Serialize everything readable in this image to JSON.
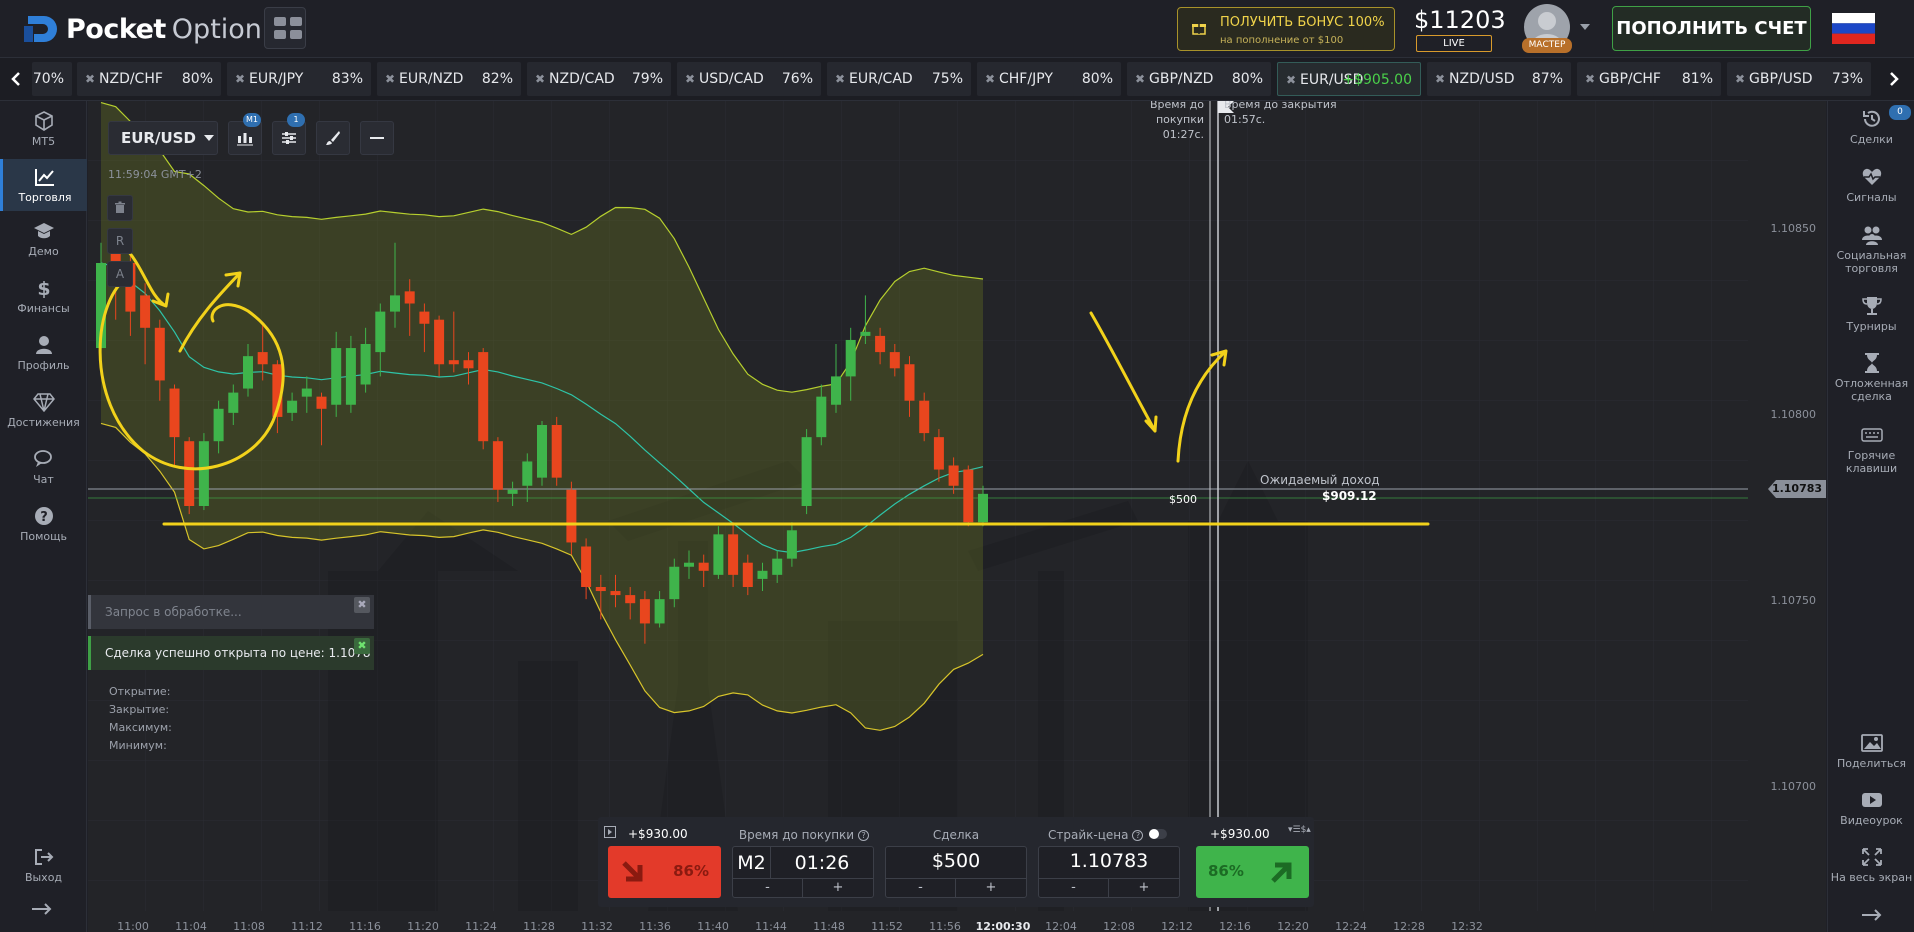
{
  "app": {
    "brand_bold": "Pocket",
    "brand_light": "Option"
  },
  "header": {
    "bonus_title": "ПОЛУЧИТЬ БОНУС 100%",
    "bonus_sub": "на пополнение от $100",
    "balance": "$11203",
    "balance_mode": "LIVE",
    "avatar_badge": "МАСТЕР",
    "deposit_label": "ПОПОЛНИТЬ СЧЕТ"
  },
  "pairs": [
    {
      "name": "",
      "pct": "70%"
    },
    {
      "name": "NZD/CHF",
      "pct": "80%"
    },
    {
      "name": "EUR/JPY",
      "pct": "83%"
    },
    {
      "name": "EUR/NZD",
      "pct": "82%"
    },
    {
      "name": "NZD/CAD",
      "pct": "79%"
    },
    {
      "name": "USD/CAD",
      "pct": "76%"
    },
    {
      "name": "EUR/CAD",
      "pct": "75%"
    },
    {
      "name": "CHF/JPY",
      "pct": "80%"
    },
    {
      "name": "GBP/NZD",
      "pct": "80%"
    },
    {
      "name": "EUR/USD",
      "pct": "+$905.00"
    },
    {
      "name": "NZD/USD",
      "pct": "87%"
    },
    {
      "name": "GBP/CHF",
      "pct": "81%"
    },
    {
      "name": "GBP/USD",
      "pct": "73%"
    }
  ],
  "left_sidebar": [
    {
      "label": "MT5",
      "icon": "cube-icon"
    },
    {
      "label": "Торговля",
      "icon": "chart-line-icon"
    },
    {
      "label": "Демо",
      "icon": "graduation-cap-icon"
    },
    {
      "label": "Финансы",
      "icon": "dollar-icon"
    },
    {
      "label": "Профиль",
      "icon": "user-icon"
    },
    {
      "label": "Достижения",
      "icon": "diamond-icon"
    },
    {
      "label": "Чат",
      "icon": "chat-icon"
    },
    {
      "label": "Помощь",
      "icon": "help-icon"
    },
    {
      "label": "Выход",
      "icon": "logout-icon"
    }
  ],
  "right_sidebar": [
    {
      "label": "Сделки",
      "icon": "history-icon",
      "badge": "0"
    },
    {
      "label": "Сигналы",
      "icon": "heartbeat-icon"
    },
    {
      "label": "Социальная торговля",
      "icon": "users-icon"
    },
    {
      "label": "Турниры",
      "icon": "trophy-icon"
    },
    {
      "label": "Отложенная сделка",
      "icon": "hourglass-icon"
    },
    {
      "label": "Горячие клавиши",
      "icon": "keyboard-icon"
    },
    {
      "label": "Поделиться",
      "icon": "image-icon"
    },
    {
      "label": "Видеоурок",
      "icon": "video-icon"
    },
    {
      "label": "На весь экран",
      "icon": "fullscreen-icon"
    }
  ],
  "chart": {
    "pair": "EUR/USD",
    "timeframe_badge": "M1",
    "indicators_badge": "1",
    "clock": "11:59:04 GMT+2",
    "tool_trash": "🗑",
    "tool_r": "R",
    "tool_a": "A",
    "time_to_buy_label": "Время до покупки",
    "time_to_buy": "01:27c.",
    "time_to_close_label": "Время до закрытия",
    "time_to_close": "01:57c.",
    "expected_income_label": "Ожидаемый доход",
    "expected_income": "$909.12",
    "stake_marker": "$500",
    "current_price": "1.10783",
    "y_ticks": [
      "1.10850",
      "1.10800",
      "1.10750",
      "1.10700"
    ],
    "x_ticks": [
      "11:00",
      "11:04",
      "11:08",
      "11:12",
      "11:16",
      "11:20",
      "11:24",
      "11:28",
      "11:32",
      "11:36",
      "11:40",
      "11:44",
      "11:48",
      "11:52",
      "11:56",
      "12:00:30",
      "12:04",
      "12:08",
      "12:12",
      "12:16",
      "12:20",
      "12:24",
      "12:28",
      "12:32"
    ]
  },
  "chart_data": {
    "type": "candlestick",
    "candles": [
      {
        "o": 1.10819,
        "c": 1.1084,
        "h": 1.10845,
        "l": 1.10815
      },
      {
        "o": 1.10845,
        "c": 1.10838,
        "h": 1.10846,
        "l": 1.10826
      },
      {
        "o": 1.1084,
        "c": 1.10828,
        "h": 1.10842,
        "l": 1.10822
      },
      {
        "o": 1.10832,
        "c": 1.10824,
        "h": 1.10835,
        "l": 1.10815
      },
      {
        "o": 1.10824,
        "c": 1.10811,
        "h": 1.10826,
        "l": 1.10806
      },
      {
        "o": 1.10809,
        "c": 1.10797,
        "h": 1.1081,
        "l": 1.1079
      },
      {
        "o": 1.10796,
        "c": 1.1078,
        "h": 1.10797,
        "l": 1.10778
      },
      {
        "o": 1.1078,
        "c": 1.10796,
        "h": 1.10798,
        "l": 1.10779
      },
      {
        "o": 1.10796,
        "c": 1.10804,
        "h": 1.10806,
        "l": 1.10793
      },
      {
        "o": 1.10803,
        "c": 1.10808,
        "h": 1.1081,
        "l": 1.108
      },
      {
        "o": 1.10809,
        "c": 1.10817,
        "h": 1.1082,
        "l": 1.10807
      },
      {
        "o": 1.10818,
        "c": 1.10815,
        "h": 1.10825,
        "l": 1.10811
      },
      {
        "o": 1.10815,
        "c": 1.10802,
        "h": 1.10816,
        "l": 1.10798
      },
      {
        "o": 1.10803,
        "c": 1.10806,
        "h": 1.10808,
        "l": 1.10801
      },
      {
        "o": 1.10807,
        "c": 1.10809,
        "h": 1.10812,
        "l": 1.10803
      },
      {
        "o": 1.10807,
        "c": 1.10804,
        "h": 1.10808,
        "l": 1.10795
      },
      {
        "o": 1.10805,
        "c": 1.10819,
        "h": 1.10823,
        "l": 1.10802
      },
      {
        "o": 1.10805,
        "c": 1.10819,
        "h": 1.10822,
        "l": 1.10803
      },
      {
        "o": 1.1081,
        "c": 1.1082,
        "h": 1.10824,
        "l": 1.10808
      },
      {
        "o": 1.10818,
        "c": 1.10828,
        "h": 1.1083,
        "l": 1.10812
      },
      {
        "o": 1.10828,
        "c": 1.10832,
        "h": 1.10845,
        "l": 1.10824
      },
      {
        "o": 1.10833,
        "c": 1.1083,
        "h": 1.10836,
        "l": 1.10822
      },
      {
        "o": 1.10828,
        "c": 1.10825,
        "h": 1.1083,
        "l": 1.10818
      },
      {
        "o": 1.10826,
        "c": 1.10815,
        "h": 1.10827,
        "l": 1.10812
      },
      {
        "o": 1.10816,
        "c": 1.10815,
        "h": 1.10828,
        "l": 1.10813
      },
      {
        "o": 1.10816,
        "c": 1.10814,
        "h": 1.10818,
        "l": 1.1081
      },
      {
        "o": 1.10818,
        "c": 1.10796,
        "h": 1.10819,
        "l": 1.10794
      },
      {
        "o": 1.10796,
        "c": 1.10784,
        "h": 1.10797,
        "l": 1.10781
      },
      {
        "o": 1.10783,
        "c": 1.10784,
        "h": 1.10786,
        "l": 1.1078
      },
      {
        "o": 1.10785,
        "c": 1.10791,
        "h": 1.10793,
        "l": 1.10781
      },
      {
        "o": 1.10787,
        "c": 1.108,
        "h": 1.10801,
        "l": 1.10785
      },
      {
        "o": 1.108,
        "c": 1.10787,
        "h": 1.10802,
        "l": 1.10785
      },
      {
        "o": 1.10784,
        "c": 1.10771,
        "h": 1.10786,
        "l": 1.10768
      },
      {
        "o": 1.1077,
        "c": 1.1076,
        "h": 1.10772,
        "l": 1.10757
      },
      {
        "o": 1.1076,
        "c": 1.10759,
        "h": 1.10763,
        "l": 1.10752
      },
      {
        "o": 1.10759,
        "c": 1.10758,
        "h": 1.10763,
        "l": 1.10755
      },
      {
        "o": 1.10758,
        "c": 1.10756,
        "h": 1.1076,
        "l": 1.10752
      },
      {
        "o": 1.10757,
        "c": 1.10751,
        "h": 1.10759,
        "l": 1.10746
      },
      {
        "o": 1.10751,
        "c": 1.10757,
        "h": 1.10759,
        "l": 1.1075
      },
      {
        "o": 1.10757,
        "c": 1.10765,
        "h": 1.10767,
        "l": 1.10755
      },
      {
        "o": 1.10765,
        "c": 1.10766,
        "h": 1.10769,
        "l": 1.10762
      },
      {
        "o": 1.10766,
        "c": 1.10764,
        "h": 1.10768,
        "l": 1.1076
      },
      {
        "o": 1.10763,
        "c": 1.10773,
        "h": 1.10775,
        "l": 1.10762
      },
      {
        "o": 1.10773,
        "c": 1.10763,
        "h": 1.10776,
        "l": 1.1076
      },
      {
        "o": 1.10766,
        "c": 1.1076,
        "h": 1.10768,
        "l": 1.10758
      },
      {
        "o": 1.10762,
        "c": 1.10764,
        "h": 1.10766,
        "l": 1.10759
      },
      {
        "o": 1.10763,
        "c": 1.10767,
        "h": 1.10769,
        "l": 1.10761
      },
      {
        "o": 1.10767,
        "c": 1.10774,
        "h": 1.10776,
        "l": 1.10765
      },
      {
        "o": 1.1078,
        "c": 1.10797,
        "h": 1.10799,
        "l": 1.10778
      },
      {
        "o": 1.10797,
        "c": 1.10807,
        "h": 1.1081,
        "l": 1.10795
      },
      {
        "o": 1.10805,
        "c": 1.10812,
        "h": 1.1082,
        "l": 1.10803
      },
      {
        "o": 1.10812,
        "c": 1.10821,
        "h": 1.10824,
        "l": 1.10806
      },
      {
        "o": 1.10822,
        "c": 1.10823,
        "h": 1.10832,
        "l": 1.1082
      },
      {
        "o": 1.10822,
        "c": 1.10818,
        "h": 1.10824,
        "l": 1.10815
      },
      {
        "o": 1.10818,
        "c": 1.10814,
        "h": 1.1082,
        "l": 1.10812
      },
      {
        "o": 1.10815,
        "c": 1.10806,
        "h": 1.10817,
        "l": 1.10802
      },
      {
        "o": 1.10806,
        "c": 1.10798,
        "h": 1.10808,
        "l": 1.10796
      },
      {
        "o": 1.10797,
        "c": 1.10789,
        "h": 1.10799,
        "l": 1.10786
      },
      {
        "o": 1.1079,
        "c": 1.10785,
        "h": 1.10792,
        "l": 1.10783
      },
      {
        "o": 1.10789,
        "c": 1.10776,
        "h": 1.1079,
        "l": 1.10775
      },
      {
        "o": 1.10776,
        "c": 1.10783,
        "h": 1.10785,
        "l": 1.10775
      }
    ],
    "y_range": [
      1.1068,
      1.1088
    ]
  },
  "notifications": {
    "pending": "Запрос в обработке...",
    "success": "Сделка успешно открыта по цене: 1.1078"
  },
  "ohlc": {
    "open": "Открытие:",
    "close": "Закрытие:",
    "max": "Максимум:",
    "min": "Минимум:"
  },
  "trade": {
    "sell_profit": "+$930.00",
    "buy_profit": "+$930.00",
    "sell_pct": "86%",
    "buy_pct": "86%",
    "time_label": "Время до покупки",
    "timeframe": "M2",
    "time_value": "01:26",
    "amount_label": "Сделка",
    "amount": "$500",
    "strike_label": "Страйк-цена",
    "strike": "1.10783",
    "minus": "-",
    "plus": "+"
  },
  "colors": {
    "up": "#3fb44b",
    "down": "#e9461e",
    "annotation": "#f2d21b",
    "bands": "#b6cf2e",
    "ma": "#2ec4a8"
  }
}
